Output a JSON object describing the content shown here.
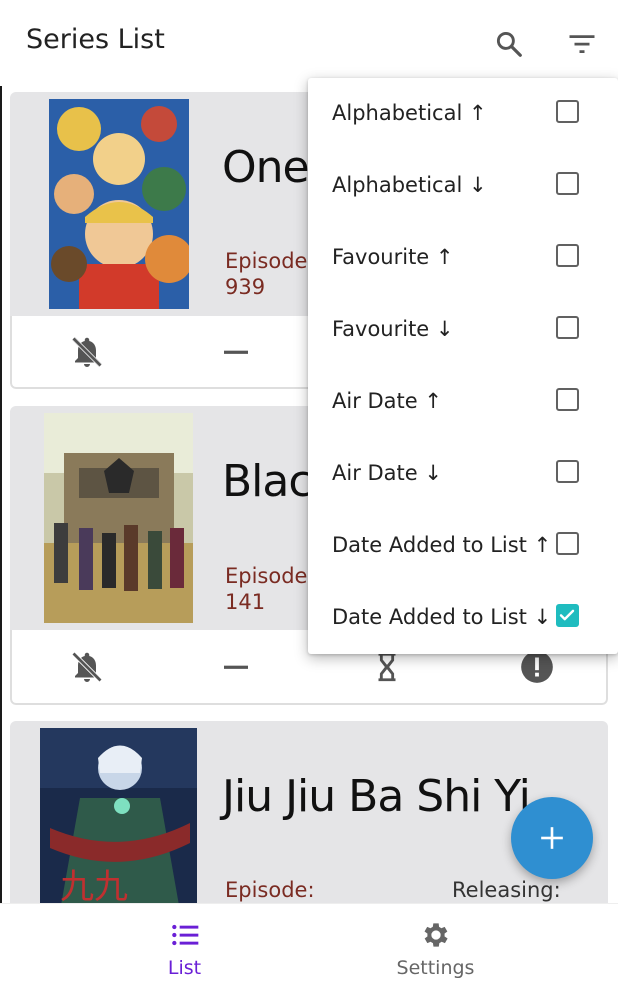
{
  "appbar": {
    "title": "Series List",
    "icons": [
      "search-icon",
      "filter-icon"
    ]
  },
  "cards": [
    {
      "title": "One",
      "episode_label": "Episode:",
      "episode_value": "939",
      "poster": "one-piece-poster"
    },
    {
      "title": "Black",
      "episode_label": "Episode:",
      "episode_value": "141",
      "poster": "black-clover-poster"
    },
    {
      "title": "Jiu Jiu Ba Shi Yi",
      "episode_label": "Episode:",
      "status_label": "Releasing:",
      "poster": "jiu-jiu-ba-shi-yi-poster"
    }
  ],
  "card_action_icons": [
    "notifications-off-icon",
    "remove-icon",
    "hourglass-icon",
    "alert-icon"
  ],
  "sort_menu": {
    "options": [
      {
        "label": "Alphabetical ↑",
        "checked": false
      },
      {
        "label": "Alphabetical ↓",
        "checked": false
      },
      {
        "label": "Favourite ↑",
        "checked": false
      },
      {
        "label": "Favourite ↓",
        "checked": false
      },
      {
        "label": "Air Date ↑",
        "checked": false
      },
      {
        "label": "Air Date ↓",
        "checked": false
      },
      {
        "label": "Date Added to List ↑",
        "checked": false
      },
      {
        "label": "Date Added to List ↓",
        "checked": true
      }
    ]
  },
  "fab": {
    "icon": "plus-icon"
  },
  "bottom_nav": {
    "items": [
      {
        "label": "List",
        "icon": "list-icon",
        "active": true
      },
      {
        "label": "Settings",
        "icon": "gear-icon",
        "active": false
      }
    ]
  },
  "colors": {
    "accent_purple": "#6a1fd6",
    "checkbox_teal": "#1fbcbf",
    "fab_blue": "#2f8fd1",
    "episode_brown": "#7a2b22",
    "card_gray": "#e5e5e7"
  }
}
